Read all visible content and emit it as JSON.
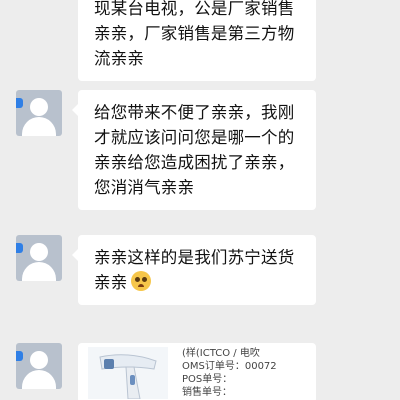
{
  "messages": [
    {
      "id": "m1",
      "text": "现某台电视，公是厂家销售亲亲，厂家销售是第三方物流亲亲"
    },
    {
      "id": "m2",
      "text": "给您带来不便了亲亲，我刚才就应该问问您是哪一个的亲亲给您造成困扰了亲亲，您消消气亲亲"
    },
    {
      "id": "m3",
      "text": "亲亲这样的是我们苏宁送货亲亲"
    },
    {
      "id": "m4",
      "image": {
        "receipt_lines": [
          "(样(ICTCO / 电吹",
          "OMS订单号：00072",
          "POS单号：",
          "销售单号："
        ]
      }
    }
  ],
  "icons": {
    "avatar": "default-user-avatar-icon",
    "emoji": "pleading-face-emoji"
  },
  "colors": {
    "background": "#ededed",
    "bubble": "#ffffff",
    "avatar": "#b8c1cd",
    "avatar_badge": "#2f7fe6"
  }
}
